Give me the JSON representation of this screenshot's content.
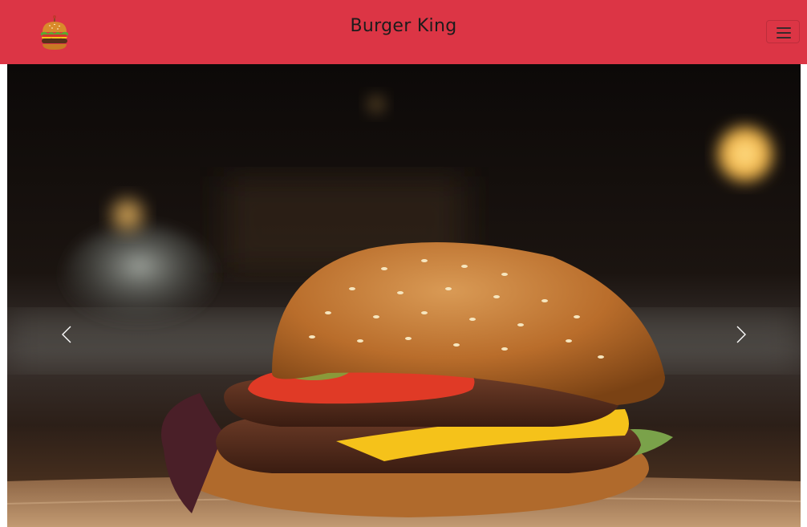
{
  "navbar": {
    "brand": "Burger King",
    "logo_icon": "burger-logo-icon",
    "toggler_icon": "hamburger-menu-icon",
    "background": "#dc3545"
  },
  "carousel": {
    "slide_image": "burger-photo",
    "prev_icon": "chevron-left-icon",
    "next_icon": "chevron-right-icon"
  }
}
